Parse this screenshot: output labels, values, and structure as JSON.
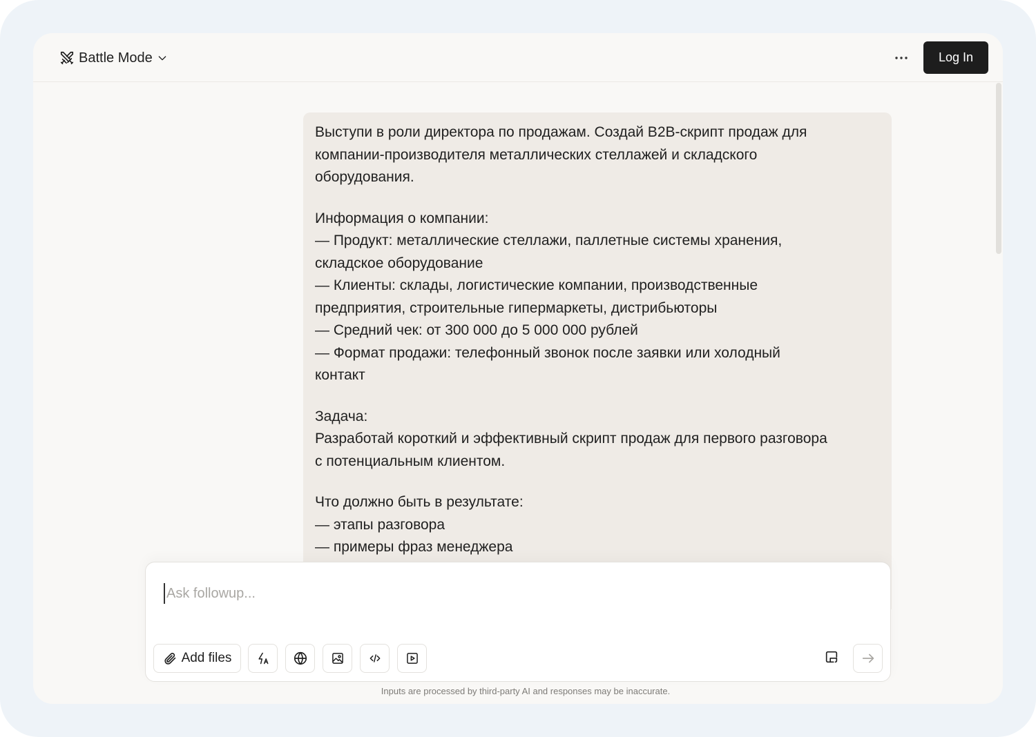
{
  "header": {
    "mode_label": "Battle Mode",
    "login_label": "Log In"
  },
  "message": {
    "paragraphs": [
      [
        "Выступи в роли директора по продажам. Создай B2B-скрипт продаж для",
        "компании-производителя металлических стеллажей и складского",
        "оборудования."
      ],
      [
        "Информация о компании:",
        "— Продукт: металлические стеллажи, паллетные системы хранения,",
        "складское оборудование",
        "— Клиенты: склады, логистические компании, производственные",
        "предприятия, строительные гипермаркеты, дистрибьюторы",
        "— Средний чек: от 300 000 до 5 000 000 рублей",
        "— Формат продажи: телефонный звонок после заявки или холодный",
        "контакт"
      ],
      [
        "Задача:",
        "Разработай короткий и эффективный скрипт продаж для первого разговора",
        "с потенциальным клиентом."
      ],
      [
        "Что должно быть в результате:",
        "— этапы разговора",
        "— примеры фраз менеджера"
      ]
    ]
  },
  "composer": {
    "placeholder": "Ask followup...",
    "value": "",
    "add_files_label": "Add files"
  },
  "toolbar_icons": [
    "paperclip-icon",
    "lightning-icon",
    "globe-icon",
    "image-icon",
    "code-icon",
    "video-icon",
    "canvas-icon",
    "arrow-right-icon"
  ],
  "disclaimer": "Inputs are processed by third-party AI and responses may be inaccurate.",
  "colors": {
    "background": "#eef3f8",
    "window": "#f9f8f6",
    "bubble": "#efebe6",
    "primary_button": "#1d1d1d"
  }
}
